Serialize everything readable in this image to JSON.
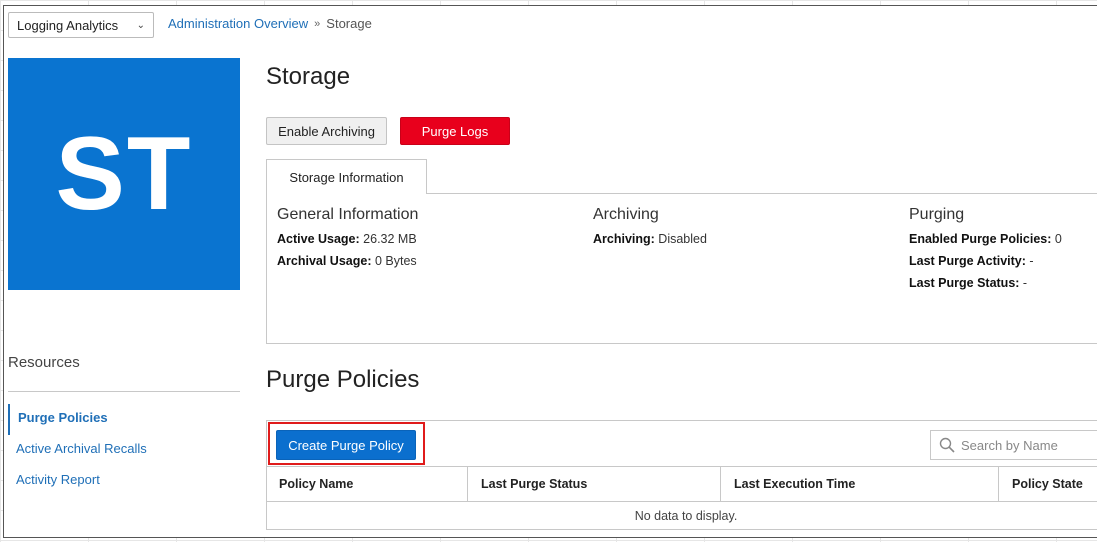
{
  "app_selector": {
    "value": "Logging Analytics"
  },
  "breadcrumb": {
    "parent": "Administration Overview",
    "current": "Storage"
  },
  "tile": {
    "initials": "ST",
    "color": "#0a74d0"
  },
  "resources": {
    "title": "Resources",
    "items": [
      {
        "label": "Purge Policies",
        "active": true
      },
      {
        "label": "Active Archival Recalls",
        "active": false
      },
      {
        "label": "Activity Report",
        "active": false
      }
    ]
  },
  "page": {
    "title": "Storage"
  },
  "actions": {
    "enable_archiving": "Enable Archiving",
    "purge_logs": "Purge Logs"
  },
  "tabs": [
    {
      "label": "Storage Information",
      "active": true
    }
  ],
  "info": {
    "general": {
      "title": "General Information",
      "active_usage_label": "Active Usage:",
      "active_usage_value": "26.32 MB",
      "archival_usage_label": "Archival Usage:",
      "archival_usage_value": "0 Bytes"
    },
    "archiving": {
      "title": "Archiving",
      "archiving_label": "Archiving:",
      "archiving_value": "Disabled"
    },
    "purging": {
      "title": "Purging",
      "enabled_label": "Enabled Purge Policies:",
      "enabled_value": "0",
      "last_activity_label": "Last Purge Activity:",
      "last_activity_value": "-",
      "last_status_label": "Last Purge Status:",
      "last_status_value": "-"
    }
  },
  "purge_policies": {
    "title": "Purge Policies",
    "create_button": "Create Purge Policy",
    "search_placeholder": "Search by Name",
    "columns": [
      "Policy Name",
      "Last Purge Status",
      "Last Execution Time",
      "Policy State"
    ],
    "empty_text": "No data to display."
  },
  "colors": {
    "accent": "#1f6fb7",
    "primary_button": "#0b6fce",
    "danger_button": "#e8001c",
    "highlight": "#e01b1b"
  }
}
